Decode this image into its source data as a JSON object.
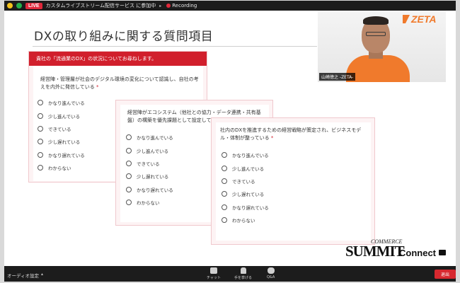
{
  "topbar": {
    "live_label": "LIVE",
    "stream_title": "カスタムライブストリーム配信サービス に参加中",
    "recording_label": "Recording"
  },
  "slide": {
    "title": "DXの取り組みに関する質問項目"
  },
  "forms": [
    {
      "header": "貴社の「流通業のDX」の状況についてお尋ねします。",
      "question": "経営陣・管理層が社会のデジタル環境の変化について認識し、自社の考えを内外に発信している",
      "required_mark": "*",
      "options": [
        "かなり進んでいる",
        "少し進んでいる",
        "できている",
        "少し遅れている",
        "かなり遅れている",
        "わからない"
      ]
    },
    {
      "question": "経営陣がエコシステム（他社との協力・データ連携・共有基盤）の構築を優先課題として設定している",
      "required_mark": "*",
      "options": [
        "かなり進んでいる",
        "少し進んでいる",
        "できている",
        "少し遅れている",
        "かなり遅れている",
        "わからない"
      ]
    },
    {
      "question": "社内のDXを推進するための経営戦略が策定され、ビジネスモデル・体制が整っている",
      "required_mark": "*",
      "options": [
        "かなり進んでいる",
        "少し進んでいる",
        "できている",
        "少し遅れている",
        "かなり遅れている",
        "わからない"
      ]
    }
  ],
  "webcam": {
    "logo_text": "ZETA",
    "name_tag": "山崎徳之 -ZETA-"
  },
  "watermark": {
    "commerce": "COMMERCE",
    "summit": "SUMMIT",
    "connect": "Connect"
  },
  "bottombar": {
    "audio_label": "オーディオ設定",
    "chat_label": "チャット",
    "raise_hand_label": "手を挙げる",
    "qa_label": "Q&A",
    "leave_label": "退出"
  },
  "colors": {
    "accent_red": "#d11f2c",
    "zeta_orange": "#f07a2c",
    "bar_dark": "#1c1c1c"
  }
}
